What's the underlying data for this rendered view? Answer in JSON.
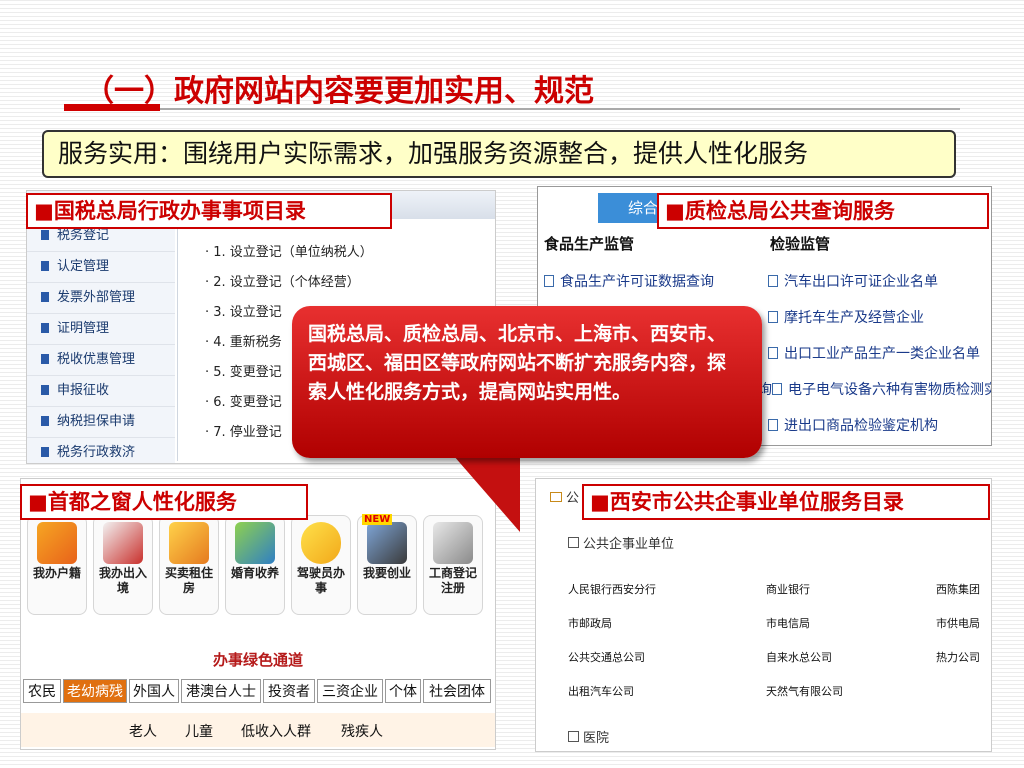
{
  "slide": {
    "title": "（一）政府网站内容要更加实用、规范",
    "subtitle": "服务实用：围绕用户实际需求，加强服务资源整合，提供人性化服务"
  },
  "labels": {
    "tax": "■国税总局行政办事事项目录",
    "quality": "■质检总局公共查询服务",
    "beijing": "■首都之窗人性化服务",
    "xian": "■西安市公共企事业单位服务目录"
  },
  "tax_panel": {
    "menu": [
      "税务登记",
      "认定管理",
      "发票外部管理",
      "证明管理",
      "税收优惠管理",
      "申报征收",
      "纳税担保申请",
      "税务行政救济"
    ],
    "list": [
      "1. 设立登记（单位纳税人）",
      "2. 设立登记（个体经营）",
      "3. 设立登记",
      "4. 重新税务",
      "5. 变更登记",
      "6. 变更登记",
      "7. 停业登记"
    ]
  },
  "quality_panel": {
    "tab": "综合",
    "col1_head": "食品生产监管",
    "col2_head": "检验监管",
    "col1_items": [
      "食品生产许可证数据查询"
    ],
    "col2_items": [
      "汽车出口许可证企业名单",
      "摩托车生产及经营企业",
      "出口工业产品生产一类企业名单",
      "电子电气设备六种有害物质检测实验室",
      "进出口商品检验鉴定机构"
    ],
    "partial": "询"
  },
  "beijing_panel": {
    "icons": [
      "我办户籍",
      "我办出入境",
      "买卖租住房",
      "婚育收养",
      "驾驶员办事",
      "我要创业",
      "工商登记注册"
    ],
    "new_badge": "NEW",
    "green_title": "办事绿色通道",
    "tabs": [
      "农民",
      "老幼病残",
      "外国人",
      "港澳台人士",
      "投资者",
      "三资企业",
      "个体",
      "社会团体"
    ],
    "subtabs": [
      "老人",
      "儿童",
      "低收入人群",
      "残疾人"
    ]
  },
  "xian_panel": {
    "header": "公",
    "section1": "公共企事业单位",
    "rows": [
      [
        "人民银行西安分行",
        "商业银行",
        "西陈集团"
      ],
      [
        "市邮政局",
        "市电信局",
        "市供电局"
      ],
      [
        "公共交通总公司",
        "自来水总公司",
        "热力公司"
      ],
      [
        "出租汽车公司",
        "天然气有限公司",
        ""
      ]
    ],
    "section2": "医院"
  },
  "callout": {
    "text": "国税总局、质检总局、北京市、上海市、西安市、西城区、福田区等政府网站不断扩充服务内容，探索人性化服务方式，提高网站实用性。"
  },
  "colors": {
    "accent": "#cc0000",
    "subtitle_bg": "#ffffc8",
    "callout": "#d01010"
  }
}
